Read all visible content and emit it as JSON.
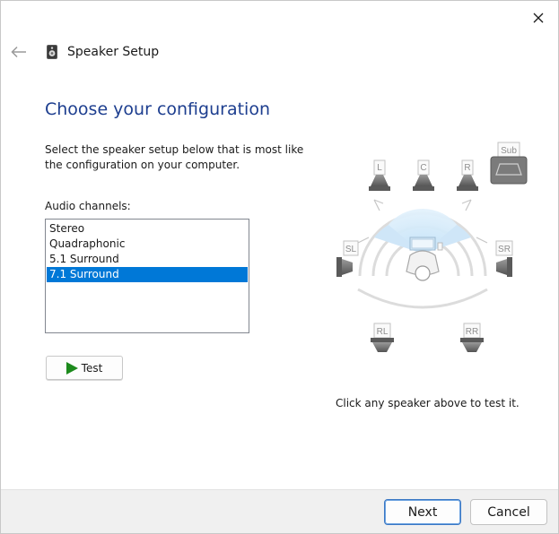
{
  "window": {
    "title": "Speaker Setup"
  },
  "page": {
    "title": "Choose your configuration",
    "instructions": "Select the speaker setup below that is most like the configuration on your computer.",
    "channels_label": "Audio channels:"
  },
  "audio_channels": {
    "items": [
      {
        "label": "Stereo"
      },
      {
        "label": "Quadraphonic"
      },
      {
        "label": "5.1 Surround"
      },
      {
        "label": "7.1 Surround"
      }
    ],
    "selected": "7.1 Surround"
  },
  "test_button": {
    "label": "Test",
    "icon": "play-icon"
  },
  "speakers": {
    "front_left": "L",
    "center": "C",
    "front_right": "R",
    "subwoofer": "Sub",
    "side_left": "SL",
    "side_right": "SR",
    "rear_left": "RL",
    "rear_right": "RR"
  },
  "hint": "Click any speaker above to test it.",
  "footer": {
    "next_label": "Next",
    "cancel_label": "Cancel"
  },
  "colors": {
    "title_blue": "#1d3e8f",
    "selection": "#0078d7",
    "play_green": "#1c8a1c",
    "sound_field": "#cfe6f8"
  }
}
